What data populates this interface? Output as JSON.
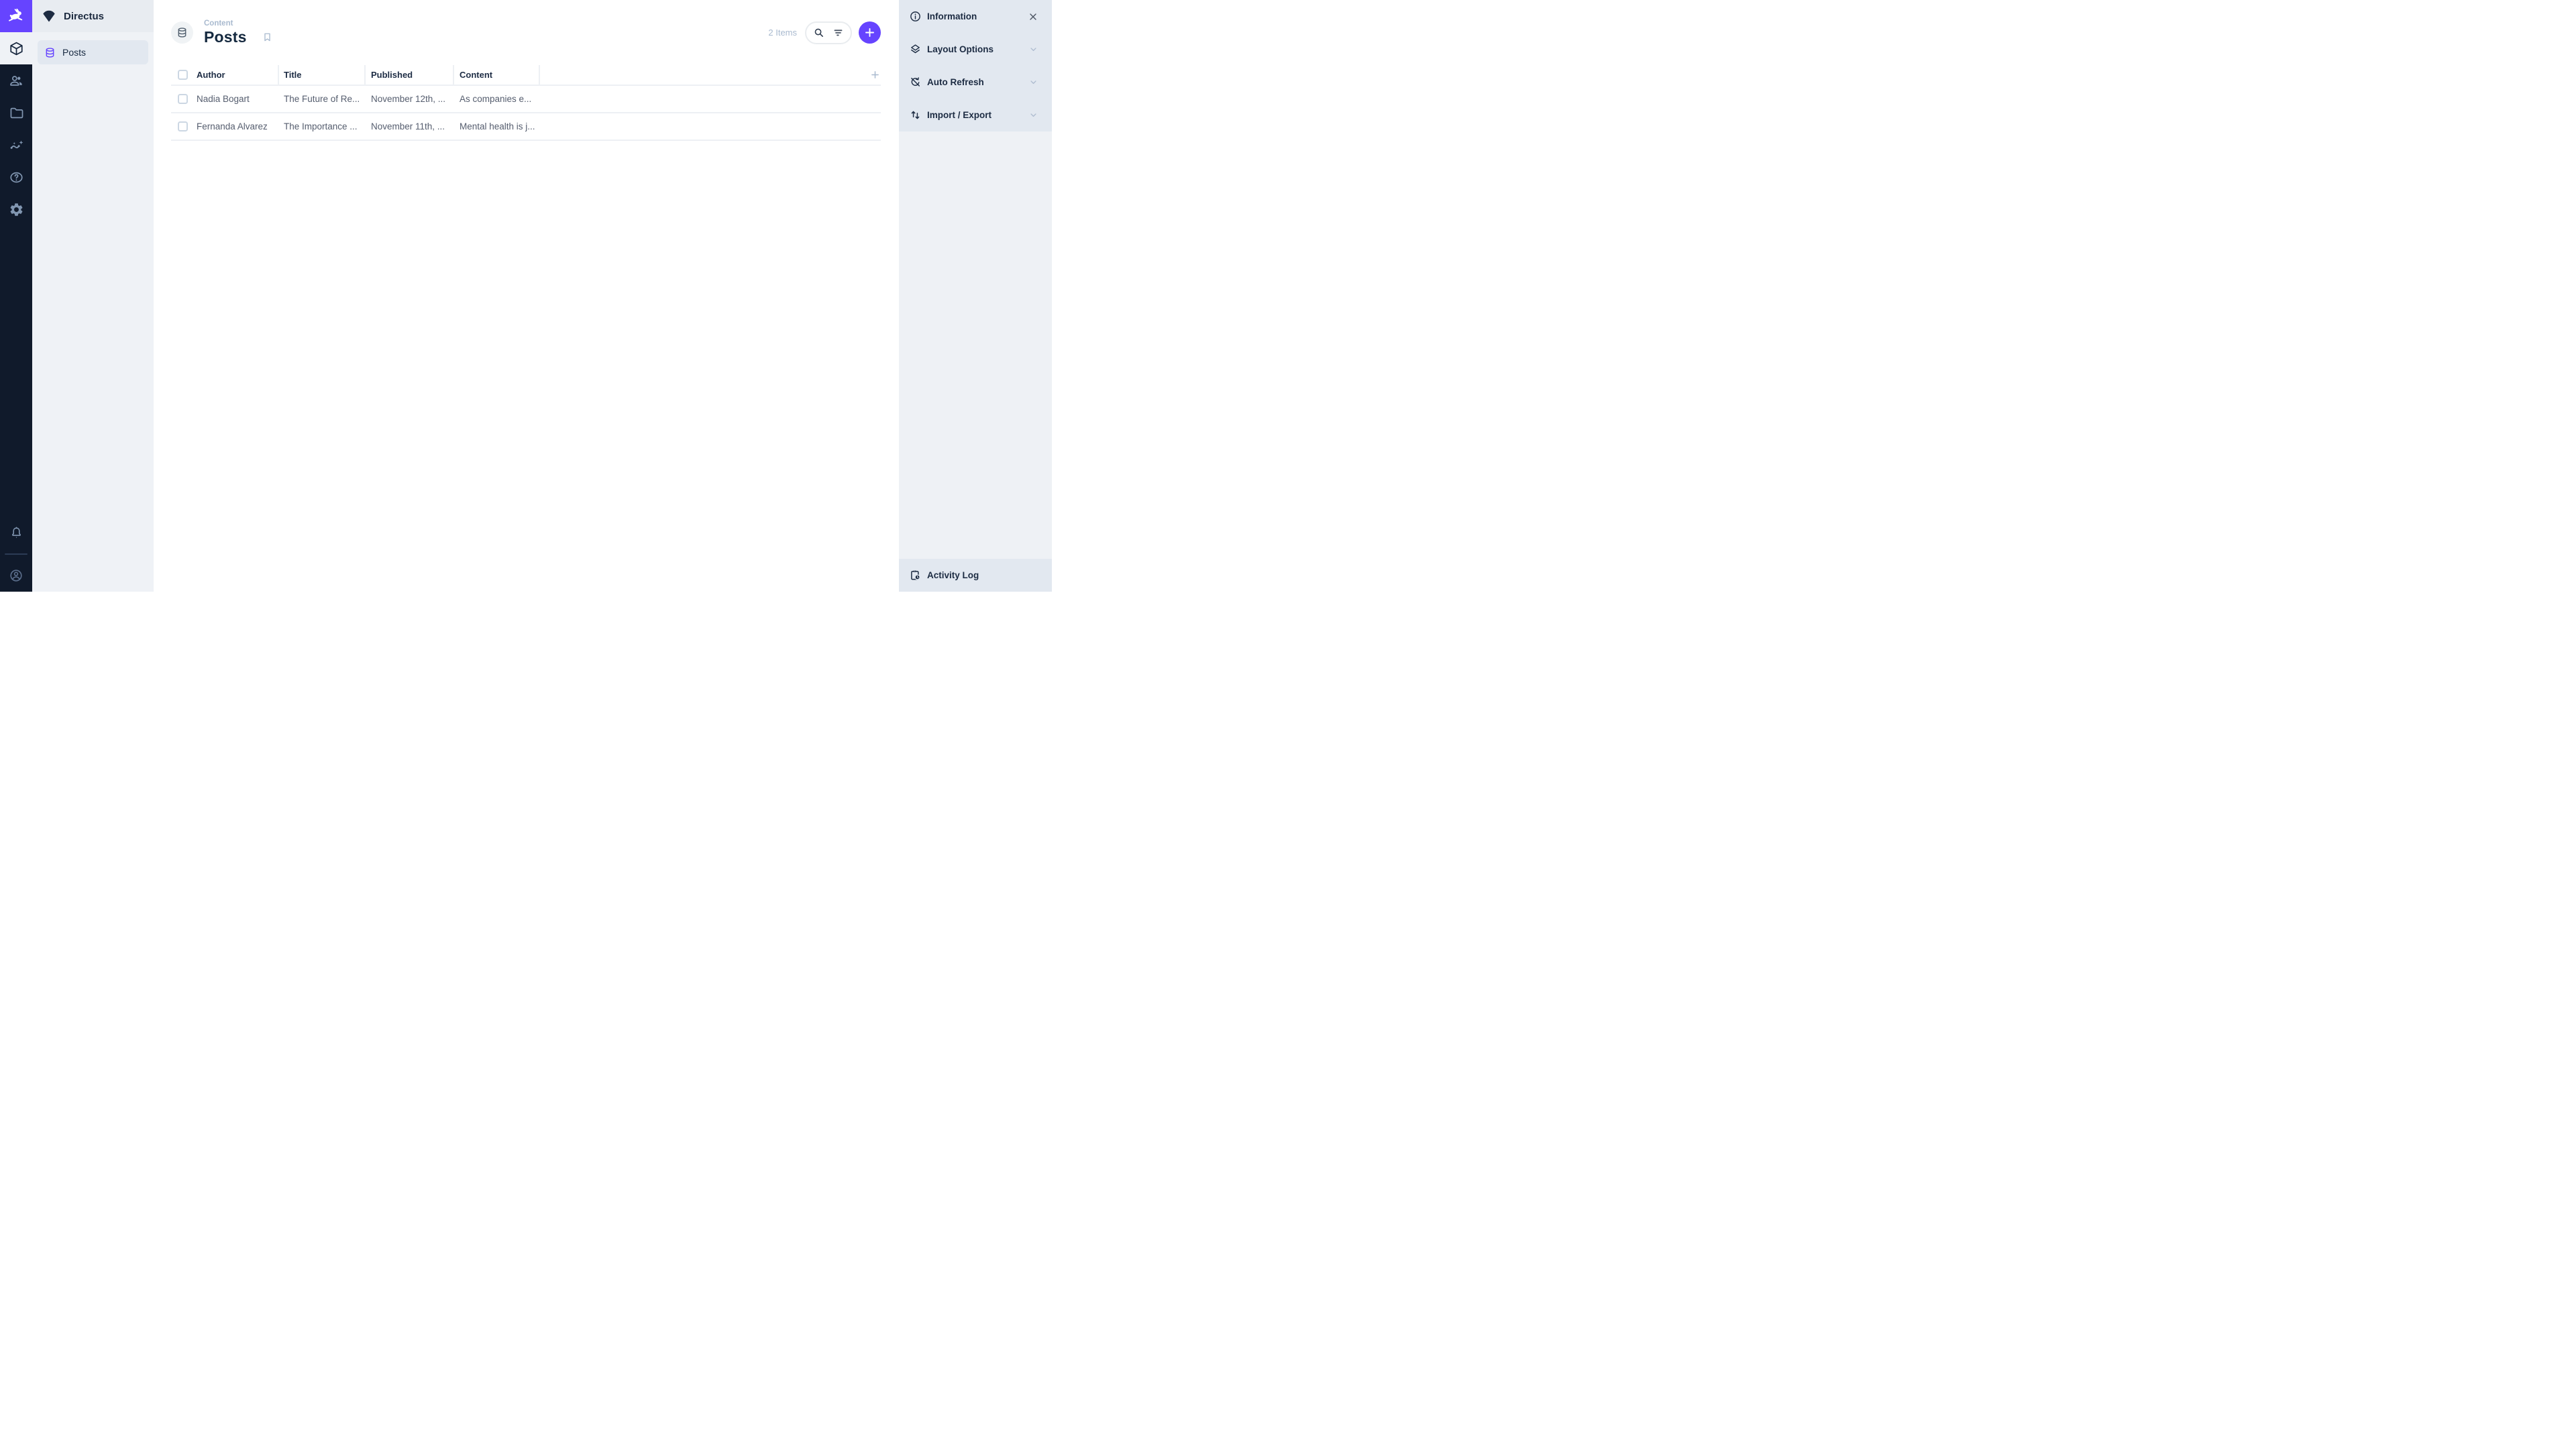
{
  "colors": {
    "brand_purple": "#6644ff",
    "module_bar_bg": "#101a2b",
    "module_icon_muted": "#8196b1",
    "panel_bg": "#eff2f6",
    "sidebar_row_bg": "#e2e8f0",
    "text_dark": "#172940",
    "text_subdued": "#a9bacf",
    "row_text": "#555d6e"
  },
  "module_bar": {
    "logo_icon": "directus-rabbit-icon",
    "modules": [
      {
        "name": "content",
        "icon": "box-icon",
        "active": true
      },
      {
        "name": "users",
        "icon": "users-icon",
        "active": false
      },
      {
        "name": "files",
        "icon": "folder-icon",
        "active": false
      },
      {
        "name": "insights",
        "icon": "insights-icon",
        "active": false
      },
      {
        "name": "help",
        "icon": "help-icon",
        "active": false
      },
      {
        "name": "settings",
        "icon": "gear-icon",
        "active": false
      }
    ],
    "bottom": [
      {
        "name": "notifications",
        "icon": "bell-icon"
      },
      {
        "name": "account",
        "icon": "account-circle-icon"
      }
    ]
  },
  "nav": {
    "project_name": "Directus",
    "project_icon": "fan-icon",
    "items": [
      {
        "label": "Posts",
        "icon": "database-icon",
        "active": true
      }
    ]
  },
  "header": {
    "breadcrumb": "Content",
    "title": "Posts",
    "collection_icon": "database-icon",
    "bookmark_icon": "bookmark-icon",
    "items_count": "2 Items",
    "search_icon": "search-icon",
    "filter_icon": "filter-icon",
    "add_icon": "plus-icon"
  },
  "table": {
    "columns": [
      "Author",
      "Title",
      "Published",
      "Content"
    ],
    "rows": [
      {
        "author": "Nadia Bogart",
        "title": "The Future of Re...",
        "published": "November 12th, ...",
        "content": "As companies e..."
      },
      {
        "author": "Fernanda Alvarez",
        "title": "The Importance ...",
        "published": "November 11th, ...",
        "content": "Mental health is j..."
      }
    ]
  },
  "sidebar": {
    "sections": [
      {
        "label": "Information",
        "icon": "info-icon",
        "trailing": "close-icon"
      },
      {
        "label": "Layout Options",
        "icon": "layers-icon",
        "trailing": "chevron-down-icon"
      },
      {
        "label": "Auto Refresh",
        "icon": "sync-disabled-icon",
        "trailing": "chevron-down-icon"
      },
      {
        "label": "Import / Export",
        "icon": "import-export-icon",
        "trailing": "chevron-down-icon"
      }
    ],
    "footer": {
      "label": "Activity Log",
      "icon": "activity-log-icon"
    }
  }
}
